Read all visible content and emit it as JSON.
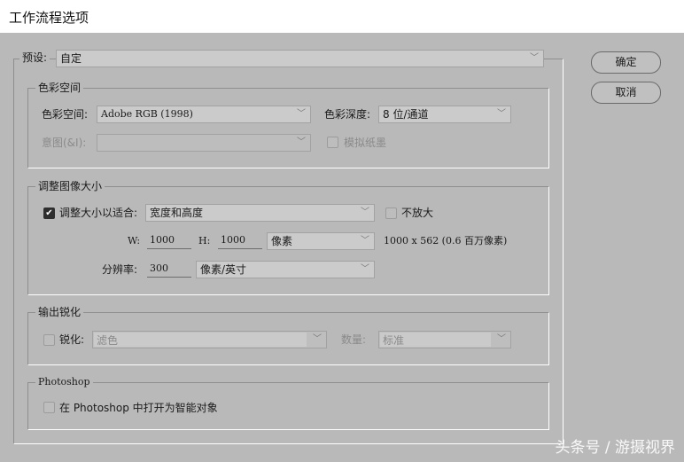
{
  "window": {
    "title": "工作流程选项"
  },
  "preset": {
    "label": "预设:",
    "value": "自定"
  },
  "buttons": {
    "ok": "确定",
    "cancel": "取消"
  },
  "color_space_group": {
    "title": "色彩空间",
    "space_label": "色彩空间:",
    "space_value": "Adobe RGB (1998)",
    "depth_label": "色彩深度:",
    "depth_value": "8 位/通道",
    "intent_label": "意图(&I):",
    "intent_value": "",
    "simulate_label": "模拟纸墨"
  },
  "resize_group": {
    "title": "调整图像大小",
    "resize_label": "调整大小以适合:",
    "resize_checked": true,
    "resize_value": "宽度和高度",
    "no_enlarge_label": "不放大",
    "w_label": "W:",
    "w_value": "1000",
    "h_label": "H:",
    "h_value": "1000",
    "unit_value": "像素",
    "size_info": "1000 x 562 (0.6 百万像素)",
    "res_label": "分辨率:",
    "res_value": "300",
    "res_unit": "像素/英寸"
  },
  "sharpen_group": {
    "title": "输出锐化",
    "sharpen_label": "锐化:",
    "sharpen_value": "滤色",
    "amount_label": "数量:",
    "amount_value": "标准"
  },
  "photoshop_group": {
    "title": "Photoshop",
    "smart_label": "在 Photoshop 中打开为智能对象"
  },
  "watermark": "头条号 / 游摄视界"
}
